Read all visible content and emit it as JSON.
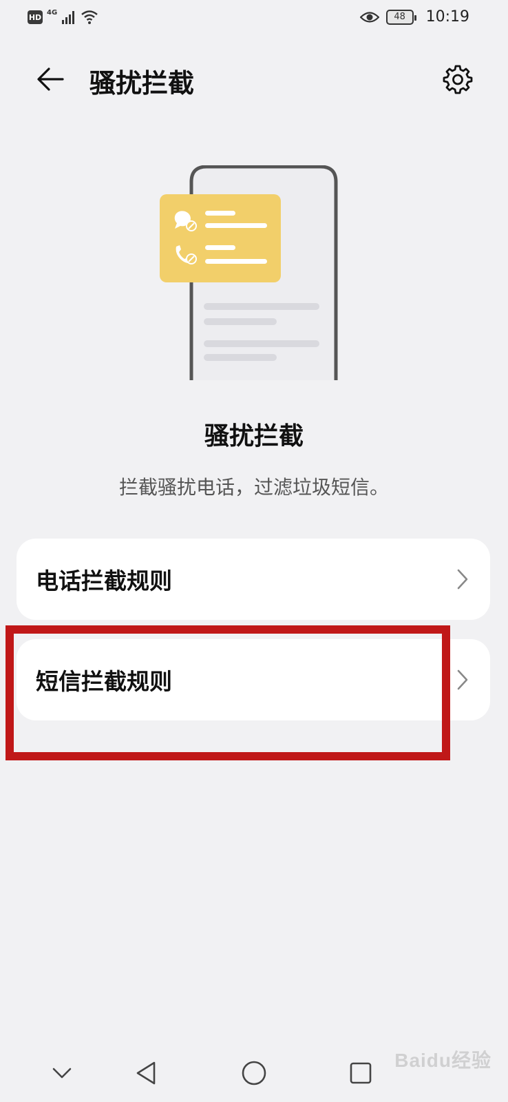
{
  "status_bar": {
    "hd": "HD",
    "network": "4G",
    "battery": "48",
    "time": "10:19"
  },
  "app_bar": {
    "title": "骚扰拦截"
  },
  "hero": {
    "title": "骚扰拦截",
    "subtitle": "拦截骚扰电话，过滤垃圾短信。"
  },
  "settings_list": [
    {
      "label": "电话拦截规则"
    },
    {
      "label": "短信拦截规则"
    }
  ],
  "watermark": "Baidu经验",
  "colors": {
    "background": "#f1f1f3",
    "card": "#ffffff",
    "highlight": "#c01818",
    "illustration_card": "#f2cf6a"
  }
}
